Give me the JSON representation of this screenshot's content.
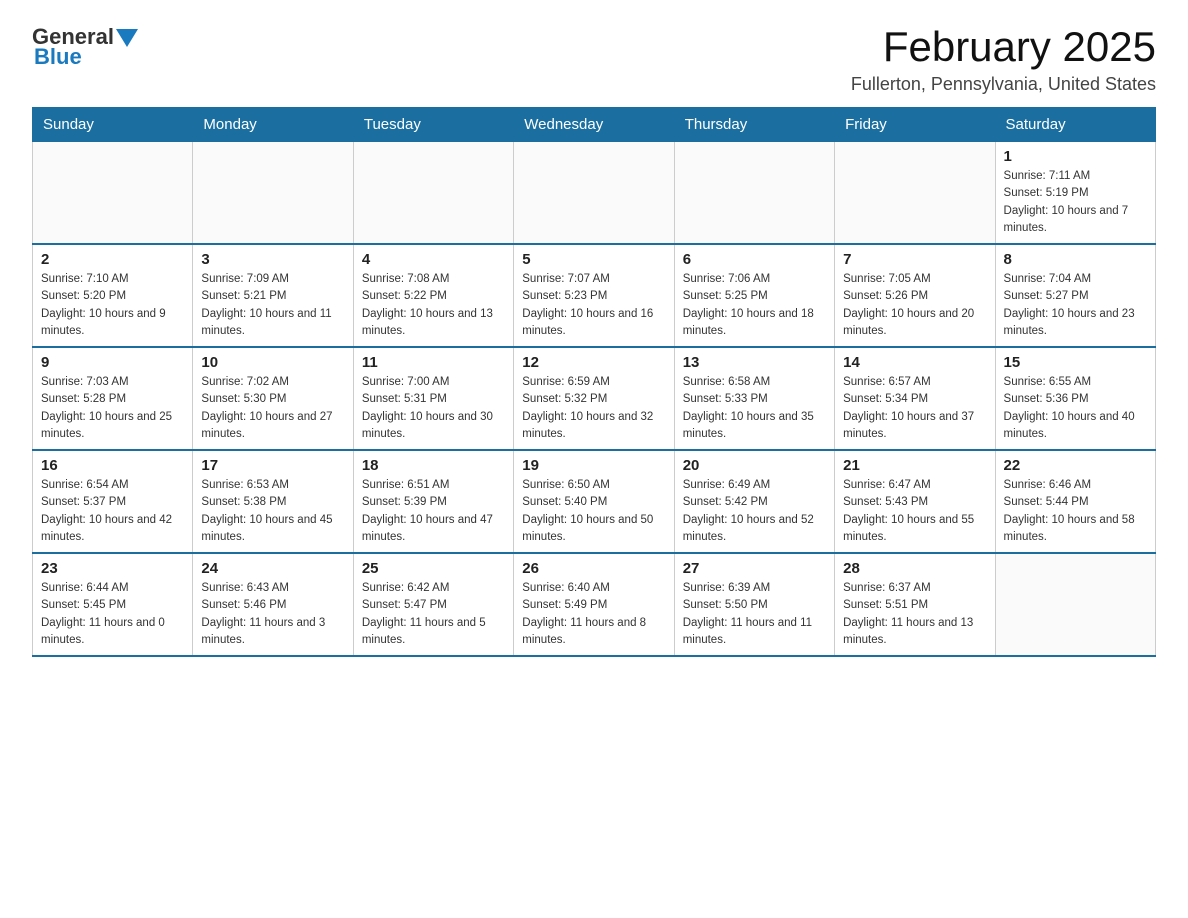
{
  "header": {
    "logo_general": "General",
    "logo_blue": "Blue",
    "month_title": "February 2025",
    "location": "Fullerton, Pennsylvania, United States"
  },
  "weekdays": [
    "Sunday",
    "Monday",
    "Tuesday",
    "Wednesday",
    "Thursday",
    "Friday",
    "Saturday"
  ],
  "weeks": [
    [
      {
        "day": "",
        "info": ""
      },
      {
        "day": "",
        "info": ""
      },
      {
        "day": "",
        "info": ""
      },
      {
        "day": "",
        "info": ""
      },
      {
        "day": "",
        "info": ""
      },
      {
        "day": "",
        "info": ""
      },
      {
        "day": "1",
        "info": "Sunrise: 7:11 AM\nSunset: 5:19 PM\nDaylight: 10 hours and 7 minutes."
      }
    ],
    [
      {
        "day": "2",
        "info": "Sunrise: 7:10 AM\nSunset: 5:20 PM\nDaylight: 10 hours and 9 minutes."
      },
      {
        "day": "3",
        "info": "Sunrise: 7:09 AM\nSunset: 5:21 PM\nDaylight: 10 hours and 11 minutes."
      },
      {
        "day": "4",
        "info": "Sunrise: 7:08 AM\nSunset: 5:22 PM\nDaylight: 10 hours and 13 minutes."
      },
      {
        "day": "5",
        "info": "Sunrise: 7:07 AM\nSunset: 5:23 PM\nDaylight: 10 hours and 16 minutes."
      },
      {
        "day": "6",
        "info": "Sunrise: 7:06 AM\nSunset: 5:25 PM\nDaylight: 10 hours and 18 minutes."
      },
      {
        "day": "7",
        "info": "Sunrise: 7:05 AM\nSunset: 5:26 PM\nDaylight: 10 hours and 20 minutes."
      },
      {
        "day": "8",
        "info": "Sunrise: 7:04 AM\nSunset: 5:27 PM\nDaylight: 10 hours and 23 minutes."
      }
    ],
    [
      {
        "day": "9",
        "info": "Sunrise: 7:03 AM\nSunset: 5:28 PM\nDaylight: 10 hours and 25 minutes."
      },
      {
        "day": "10",
        "info": "Sunrise: 7:02 AM\nSunset: 5:30 PM\nDaylight: 10 hours and 27 minutes."
      },
      {
        "day": "11",
        "info": "Sunrise: 7:00 AM\nSunset: 5:31 PM\nDaylight: 10 hours and 30 minutes."
      },
      {
        "day": "12",
        "info": "Sunrise: 6:59 AM\nSunset: 5:32 PM\nDaylight: 10 hours and 32 minutes."
      },
      {
        "day": "13",
        "info": "Sunrise: 6:58 AM\nSunset: 5:33 PM\nDaylight: 10 hours and 35 minutes."
      },
      {
        "day": "14",
        "info": "Sunrise: 6:57 AM\nSunset: 5:34 PM\nDaylight: 10 hours and 37 minutes."
      },
      {
        "day": "15",
        "info": "Sunrise: 6:55 AM\nSunset: 5:36 PM\nDaylight: 10 hours and 40 minutes."
      }
    ],
    [
      {
        "day": "16",
        "info": "Sunrise: 6:54 AM\nSunset: 5:37 PM\nDaylight: 10 hours and 42 minutes."
      },
      {
        "day": "17",
        "info": "Sunrise: 6:53 AM\nSunset: 5:38 PM\nDaylight: 10 hours and 45 minutes."
      },
      {
        "day": "18",
        "info": "Sunrise: 6:51 AM\nSunset: 5:39 PM\nDaylight: 10 hours and 47 minutes."
      },
      {
        "day": "19",
        "info": "Sunrise: 6:50 AM\nSunset: 5:40 PM\nDaylight: 10 hours and 50 minutes."
      },
      {
        "day": "20",
        "info": "Sunrise: 6:49 AM\nSunset: 5:42 PM\nDaylight: 10 hours and 52 minutes."
      },
      {
        "day": "21",
        "info": "Sunrise: 6:47 AM\nSunset: 5:43 PM\nDaylight: 10 hours and 55 minutes."
      },
      {
        "day": "22",
        "info": "Sunrise: 6:46 AM\nSunset: 5:44 PM\nDaylight: 10 hours and 58 minutes."
      }
    ],
    [
      {
        "day": "23",
        "info": "Sunrise: 6:44 AM\nSunset: 5:45 PM\nDaylight: 11 hours and 0 minutes."
      },
      {
        "day": "24",
        "info": "Sunrise: 6:43 AM\nSunset: 5:46 PM\nDaylight: 11 hours and 3 minutes."
      },
      {
        "day": "25",
        "info": "Sunrise: 6:42 AM\nSunset: 5:47 PM\nDaylight: 11 hours and 5 minutes."
      },
      {
        "day": "26",
        "info": "Sunrise: 6:40 AM\nSunset: 5:49 PM\nDaylight: 11 hours and 8 minutes."
      },
      {
        "day": "27",
        "info": "Sunrise: 6:39 AM\nSunset: 5:50 PM\nDaylight: 11 hours and 11 minutes."
      },
      {
        "day": "28",
        "info": "Sunrise: 6:37 AM\nSunset: 5:51 PM\nDaylight: 11 hours and 13 minutes."
      },
      {
        "day": "",
        "info": ""
      }
    ]
  ]
}
